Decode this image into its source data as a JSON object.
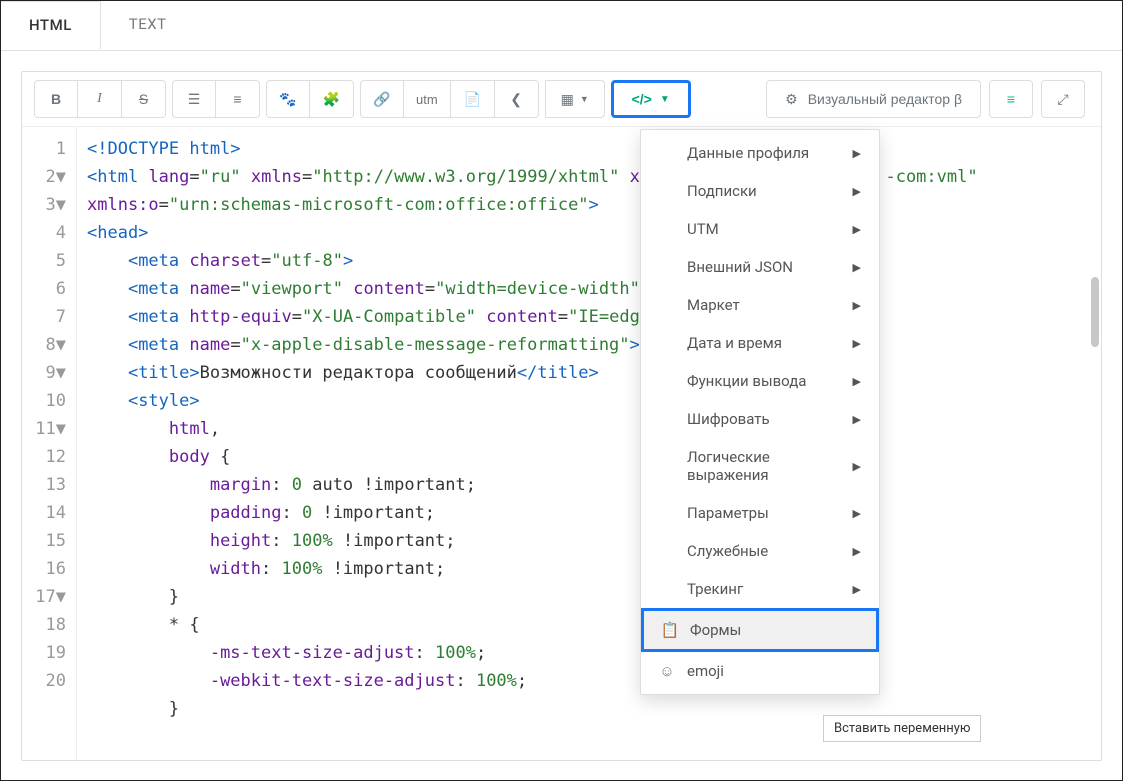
{
  "tabs": {
    "html": "HTML",
    "text": "TEXT"
  },
  "toolbar": {
    "bold": "B",
    "italic": "I",
    "strike": "S",
    "utm": "utm",
    "visual_editor": "Визуальный редактор β"
  },
  "dropdown": {
    "items": [
      {
        "label": "Данные профиля",
        "has_sub": true
      },
      {
        "label": "Подписки",
        "has_sub": true
      },
      {
        "label": "UTM",
        "has_sub": true
      },
      {
        "label": "Внешний JSON",
        "has_sub": true
      },
      {
        "label": "Маркет",
        "has_sub": true
      },
      {
        "label": "Дата и время",
        "has_sub": true
      },
      {
        "label": "Функции вывода",
        "has_sub": true
      },
      {
        "label": "Шифровать",
        "has_sub": true
      },
      {
        "label": "Логические выражения",
        "has_sub": true
      },
      {
        "label": "Параметры",
        "has_sub": true
      },
      {
        "label": "Служебные",
        "has_sub": true
      },
      {
        "label": "Трекинг",
        "has_sub": true
      },
      {
        "label": "Формы",
        "has_sub": false,
        "icon": "clipboard",
        "highlight": true
      },
      {
        "label": "emoji",
        "has_sub": false,
        "icon": "smile"
      }
    ]
  },
  "tooltip": "Вставить переменную",
  "code": {
    "lines": [
      {
        "n": 1,
        "html": "<span class='tag'>&lt;!DOCTYPE html&gt;</span>"
      },
      {
        "n": 2,
        "fold": true,
        "html": "<span class='tag'>&lt;html</span> <span class='attr'>lang</span>=<span class='str'>\"ru\"</span> <span class='attr'>xmlns</span>=<span class='str'>\"http://www.w3.org/1999/xhtml\"</span> <span class='attr'>xmlns</span>                    <span class='str'>-com:vml\"</span>\n<span class='attr'>xmlns:o</span>=<span class='str'>\"urn:schemas-microsoft-com:office:office\"</span><span class='tag'>&gt;</span>"
      },
      {
        "n": 3,
        "fold": true,
        "html": "<span class='tag'>&lt;head&gt;</span>"
      },
      {
        "n": 4,
        "html": "    <span class='tag'>&lt;meta</span> <span class='attr'>charset</span>=<span class='str'>\"utf-8\"</span><span class='tag'>&gt;</span>"
      },
      {
        "n": 5,
        "html": "    <span class='tag'>&lt;meta</span> <span class='attr'>name</span>=<span class='str'>\"viewport\"</span> <span class='attr'>content</span>=<span class='str'>\"width=device-width\"</span><span class='tag'>&gt;</span>"
      },
      {
        "n": 6,
        "html": "    <span class='tag'>&lt;meta</span> <span class='attr'>http-equiv</span>=<span class='str'>\"X-UA-Compatible\"</span> <span class='attr'>content</span>=<span class='str'>\"IE=edge\"</span><span class='tag'>&gt;</span>"
      },
      {
        "n": 7,
        "html": "    <span class='tag'>&lt;meta</span> <span class='attr'>name</span>=<span class='str'>\"x-apple-disable-message-reformatting\"</span><span class='tag'>&gt;</span>"
      },
      {
        "n": 8,
        "fold": true,
        "html": "    <span class='tag'>&lt;title&gt;</span><span class='txt'>Возможности редактора сообщений</span><span class='tag'>&lt;/title&gt;</span>"
      },
      {
        "n": 9,
        "fold": true,
        "html": "    <span class='tag'>&lt;style&gt;</span>"
      },
      {
        "n": 10,
        "html": "        <span class='prop'>html</span>,"
      },
      {
        "n": 11,
        "fold": true,
        "html": "        <span class='prop'>body</span> {"
      },
      {
        "n": 12,
        "html": "            <span class='prop'>margin</span>: <span class='num'>0</span> auto !important;"
      },
      {
        "n": 13,
        "html": "            <span class='prop'>padding</span>: <span class='num'>0</span> !important;"
      },
      {
        "n": 14,
        "html": "            <span class='prop'>height</span>: <span class='num'>100%</span> !important;"
      },
      {
        "n": 15,
        "html": "            <span class='prop'>width</span>: <span class='num'>100%</span> !important;"
      },
      {
        "n": 16,
        "html": "        }"
      },
      {
        "n": 17,
        "fold": true,
        "html": "        * {"
      },
      {
        "n": 18,
        "html": "            <span class='prop'>-ms-text-size-adjust</span>: <span class='num'>100%</span>;"
      },
      {
        "n": 19,
        "html": "            <span class='prop'>-webkit-text-size-adjust</span>: <span class='num'>100%</span>;"
      },
      {
        "n": 20,
        "html": "        }"
      }
    ]
  }
}
